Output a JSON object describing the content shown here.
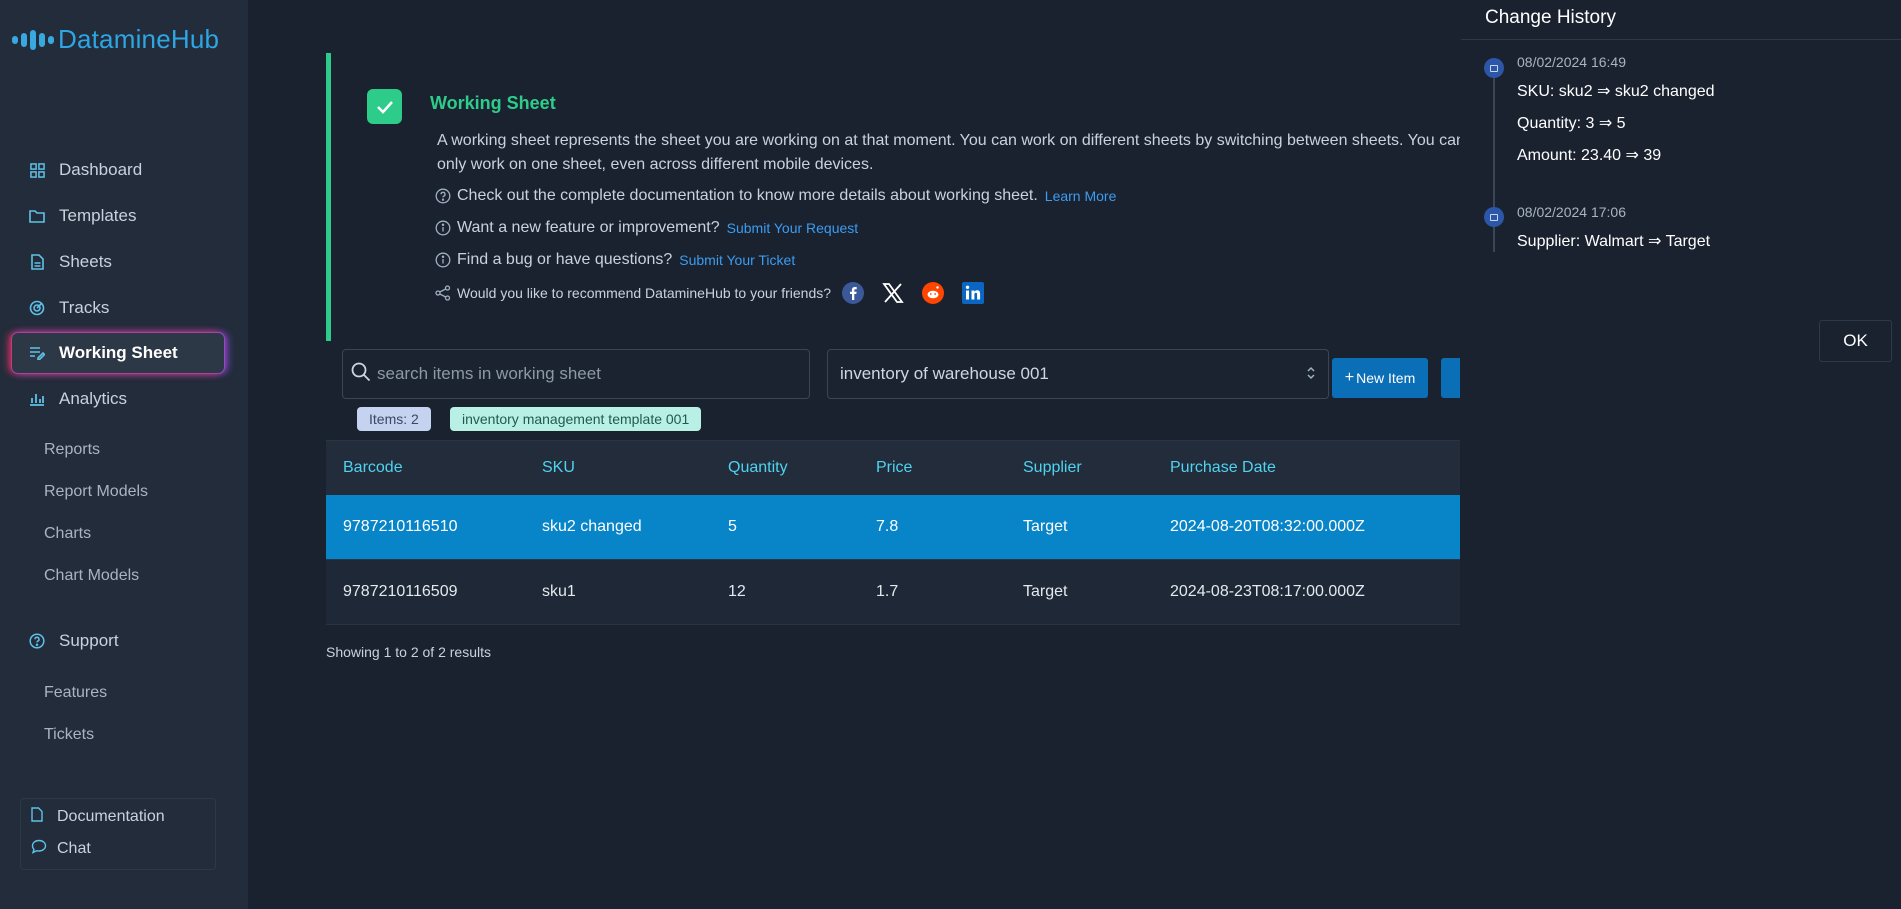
{
  "brand": {
    "name": "DatamineHub"
  },
  "sidebar": {
    "items": [
      {
        "label": "Dashboard",
        "icon": "grid-icon"
      },
      {
        "label": "Templates",
        "icon": "folder-icon"
      },
      {
        "label": "Sheets",
        "icon": "file-icon"
      },
      {
        "label": "Tracks",
        "icon": "radar-icon"
      },
      {
        "label": "Working Sheet",
        "icon": "edit-list-icon"
      },
      {
        "label": "Analytics",
        "icon": "bar-chart-icon"
      }
    ],
    "analytics_sub": [
      "Reports",
      "Report Models",
      "Charts",
      "Chart Models"
    ],
    "support": {
      "label": "Support",
      "icon": "help-circle-icon"
    },
    "support_sub": [
      "Features",
      "Tickets"
    ],
    "bottom": [
      {
        "label": "Documentation",
        "icon": "document-icon"
      },
      {
        "label": "Chat",
        "icon": "chat-icon"
      }
    ]
  },
  "info": {
    "title": "Working Sheet",
    "description": "A working sheet represents the sheet you are working on at that moment. You can work on different sheets by switching between sheets. You can only work on one sheet, even across different mobile devices.",
    "doc_text": "Check out the complete documentation to know more details about working sheet.",
    "doc_link": "Learn More",
    "feature_text": "Want a new feature or improvement?",
    "feature_link": "Submit Your Request",
    "bug_text": "Find a bug or have questions?",
    "bug_link": "Submit Your Ticket",
    "share_text": "Would you like to recommend DatamineHub to your friends?"
  },
  "search": {
    "placeholder": "search items in working sheet"
  },
  "sheet_select": {
    "value": "inventory of warehouse 001"
  },
  "new_item_label": "New Item",
  "chips": {
    "items": "Items: 2",
    "template": "inventory management template 001"
  },
  "table": {
    "headers": [
      "Barcode",
      "SKU",
      "Quantity",
      "Price",
      "Supplier",
      "Purchase Date"
    ],
    "rows": [
      [
        "9787210116510",
        "sku2 changed",
        "5",
        "7.8",
        "Target",
        "2024-08-20T08:32:00.000Z"
      ],
      [
        "9787210116509",
        "sku1",
        "12",
        "1.7",
        "Target",
        "2024-08-23T08:17:00.000Z"
      ]
    ]
  },
  "footer": {
    "text": "Showing 1 to 2 of 2 results"
  },
  "history": {
    "title": "Change History",
    "entries": [
      {
        "time": "08/02/2024 16:49",
        "changes": [
          "SKU: sku2 ⇒ sku2 changed",
          "Quantity: 3 ⇒ 5",
          "Amount: 23.40 ⇒ 39"
        ]
      },
      {
        "time": "08/02/2024 17:06",
        "changes": [
          "Supplier: Walmart ⇒ Target"
        ]
      }
    ],
    "ok_label": "OK"
  },
  "colors": {
    "accent": "#2ecc8a",
    "primary": "#0b6fb8",
    "selected_row": "#0884c8",
    "header_text": "#4fd3f0"
  }
}
